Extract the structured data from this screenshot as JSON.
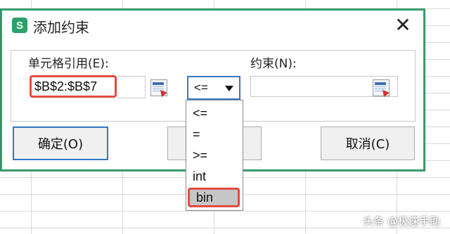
{
  "dialog": {
    "app_icon": "S",
    "title": "添加约束",
    "close_symbol": "✕"
  },
  "form": {
    "cell_ref_label": "单元格引用(E):",
    "cell_ref_value": "$B$2:$B$7",
    "operator_value": "<=",
    "constraint_label": "约束(N):",
    "constraint_value": ""
  },
  "dropdown": {
    "options": [
      "<=",
      "=",
      ">=",
      "int",
      "bin"
    ],
    "selected": "bin"
  },
  "buttons": {
    "ok_label": "确定(O)",
    "middle_label": "",
    "cancel_label": "取消(C)"
  },
  "watermark": "头条 @极速手助",
  "colors": {
    "accent_green": "#3aa06f",
    "highlight_red": "#e24a3f",
    "focus_blue": "#2f78c8"
  },
  "icons": [
    "wps-spreadsheet-icon",
    "close-icon",
    "range-picker-icon",
    "chevron-down-icon"
  ]
}
